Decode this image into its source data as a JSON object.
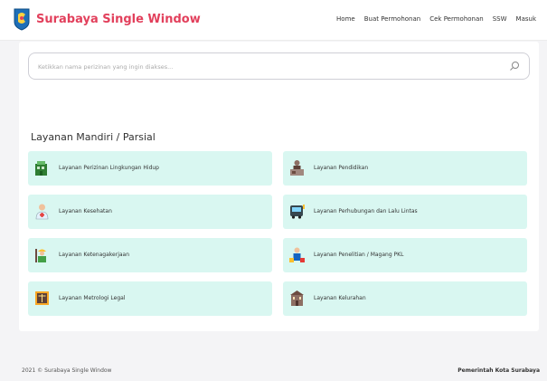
{
  "header": {
    "brand": "Surabaya Single Window",
    "nav": [
      "Home",
      "Buat Permohonan",
      "Cek Permohonan",
      "SSW",
      "Masuk"
    ]
  },
  "search": {
    "placeholder": "Ketikkan nama perizinan yang ingin diakses..."
  },
  "section": {
    "title": "Layanan Mandiri / Parsial"
  },
  "services": [
    {
      "label": "Layanan Perizinan Lingkungan Hidup",
      "icon": "building-icon"
    },
    {
      "label": "Layanan Pendidikan",
      "icon": "teacher-desk-icon"
    },
    {
      "label": "Layanan Kesehatan",
      "icon": "doctor-icon"
    },
    {
      "label": "Layanan Perhubungan dan Lalu Lintas",
      "icon": "bus-icon"
    },
    {
      "label": "Layanan Ketenagakerjaan",
      "icon": "worker-icon"
    },
    {
      "label": "Layanan Penelitian / Magang PKL",
      "icon": "researcher-icon"
    },
    {
      "label": "Layanan Metrologi Legal",
      "icon": "scale-book-icon"
    },
    {
      "label": "Layanan Kelurahan",
      "icon": "office-building-icon"
    }
  ],
  "footer": {
    "left": "2021 © Surabaya Single Window",
    "right": "Pemerintah Kota Surabaya"
  },
  "colors": {
    "brand": "#e2405c",
    "tile_background": "#d9f7f1"
  }
}
